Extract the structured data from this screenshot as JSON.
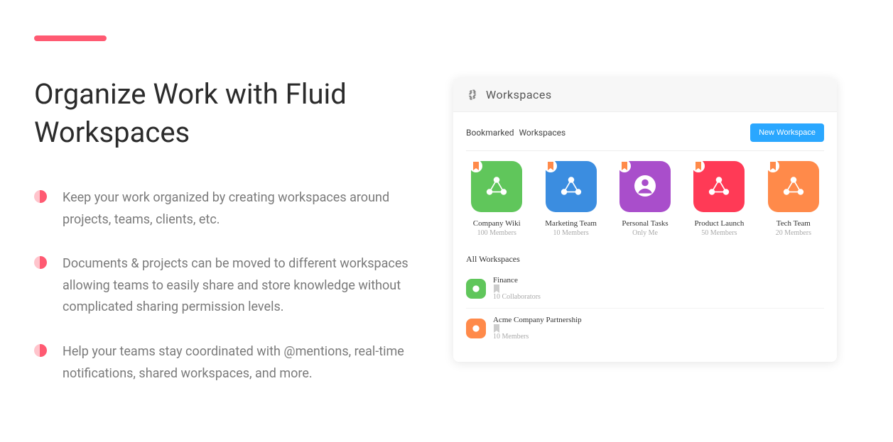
{
  "left": {
    "heading": "Organize Work with Fluid Workspaces",
    "bullets": [
      "Keep your work organized by creating workspaces around projects, teams, clients, etc.",
      "Documents & projects can be moved to different workspaces allowing teams to easily share and store knowledge without complicated sharing permission levels.",
      "Help your teams stay coordinated with @mentions, real-time notifications, shared workspaces, and more."
    ]
  },
  "card": {
    "title": "Workspaces",
    "bookmarked_label_a": "Bookmarked",
    "bookmarked_label_b": "Workspaces",
    "new_button": "New Workspace",
    "tiles": [
      {
        "name": "Company Wiki",
        "sub": "100 Members",
        "color": "#60c65b",
        "icon": "share"
      },
      {
        "name": "Marketing  Team",
        "sub": "10 Members",
        "color": "#3b8de0",
        "icon": "share"
      },
      {
        "name": "Personal  Tasks",
        "sub": "Only Me",
        "color": "#a94ecb",
        "icon": "avatar"
      },
      {
        "name": "Product Launch",
        "sub": "50 Members",
        "color": "#ff3a56",
        "icon": "share"
      },
      {
        "name": "Tech  Team",
        "sub": "20 Members",
        "color": "#ff8a4a",
        "icon": "share"
      }
    ],
    "all_label": "All Workspaces",
    "rows": [
      {
        "name": "Finance",
        "sub": "10 Collaborators",
        "color": "#60c65b"
      },
      {
        "name": "Acme Company Partnership",
        "sub": "10 Members",
        "color": "#ff8a4a"
      }
    ]
  },
  "colors": {
    "accent": "#ff5a72",
    "blue_btn": "#2aa7ff"
  }
}
